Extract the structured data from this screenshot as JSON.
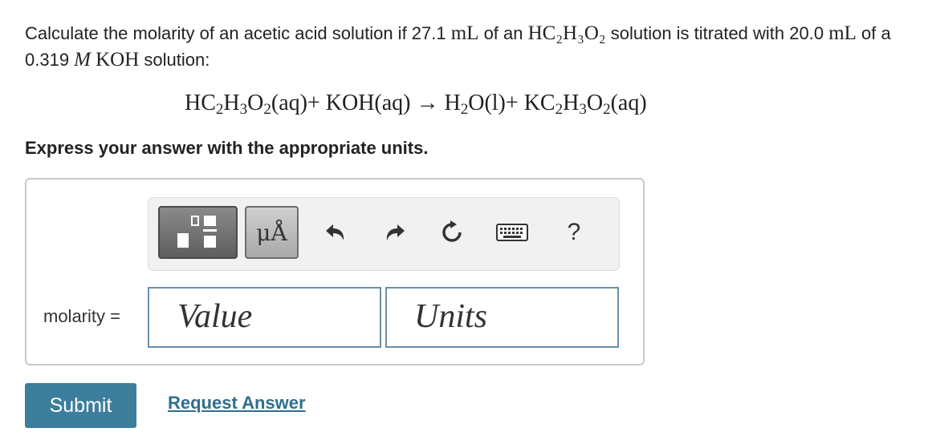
{
  "question": {
    "prefix": "Calculate the molarity of an acetic acid solution if 27.1 ",
    "unit_ml_1": "mL",
    "mid1": " of an ",
    "formula": "HC₂H₃O₂",
    "mid2": " solution is titrated with 20.0 ",
    "unit_ml_2": "mL",
    "mid3": " of a 0.319 ",
    "molar": "M",
    "base": "KOH",
    "suffix": " solution:"
  },
  "equation": {
    "r1_a": "HC",
    "r1_s1": "2",
    "r1_b": "H",
    "r1_s2": "3",
    "r1_c": "O",
    "r1_s3": "2",
    "r1_state": "(aq)",
    "plus1": "+ ",
    "r2": "KOH(aq)",
    "arrow": " → ",
    "p1_a": "H",
    "p1_s1": "2",
    "p1_b": "O(l)",
    "plus2": "+ ",
    "p2_a": "KC",
    "p2_s1": "2",
    "p2_b": "H",
    "p2_s2": "3",
    "p2_c": "O",
    "p2_s3": "2",
    "p2_state": "(aq)"
  },
  "instruction": "Express your answer with the appropriate units.",
  "toolbar": {
    "units_label": "μÅ",
    "help_label": "?",
    "icons": [
      "templates-icon",
      "units-icon",
      "undo-icon",
      "redo-icon",
      "reset-icon",
      "keyboard-icon",
      "help-icon"
    ]
  },
  "answer": {
    "variable_label": "molarity =",
    "value_placeholder": "Value",
    "units_placeholder": "Units"
  },
  "actions": {
    "submit_label": "Submit",
    "request_label": "Request Answer"
  },
  "colors": {
    "submit_bg": "#3c7e9c",
    "link": "#2f6e8e",
    "field_border": "#6a8fa6"
  }
}
